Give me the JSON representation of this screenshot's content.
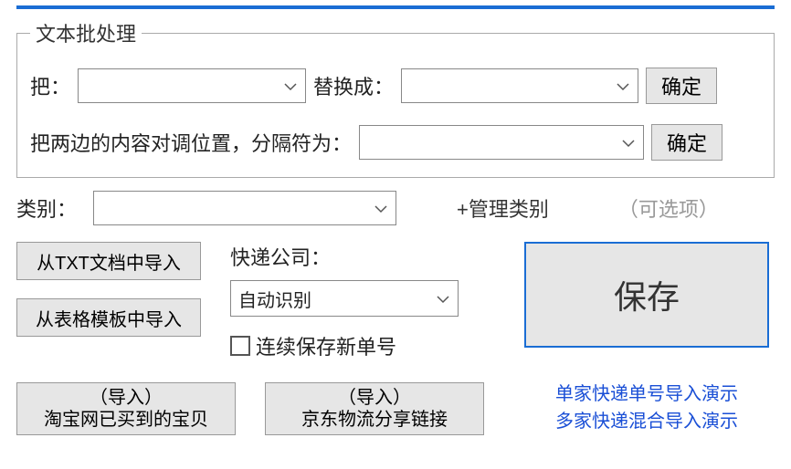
{
  "text_batch": {
    "legend": "文本批处理",
    "replace_from_label": "把：",
    "replace_from_value": "",
    "replace_to_label": "替换成：",
    "replace_to_value": "",
    "confirm": "确定",
    "swap_label": "把两边的内容对调位置，分隔符为：",
    "swap_delimiter_value": "",
    "confirm2": "确定"
  },
  "category": {
    "label": "类别：",
    "value": "",
    "manage": "+管理类别",
    "optional": "（可选项）"
  },
  "import": {
    "txt": "从TXT文档中导入",
    "template": "从表格模板中导入"
  },
  "courier": {
    "label": "快递公司：",
    "selected": "自动识别",
    "continuous_save": "连续保存新单号"
  },
  "save_button": "保存",
  "import_buttons": {
    "taobao_top": "（导入）",
    "taobao_bottom": "淘宝网已买到的宝贝",
    "jd_top": "（导入）",
    "jd_bottom": "京东物流分享链接"
  },
  "demo_links": {
    "single": "单家快递单号导入演示",
    "multi": "多家快递混合导入演示"
  }
}
